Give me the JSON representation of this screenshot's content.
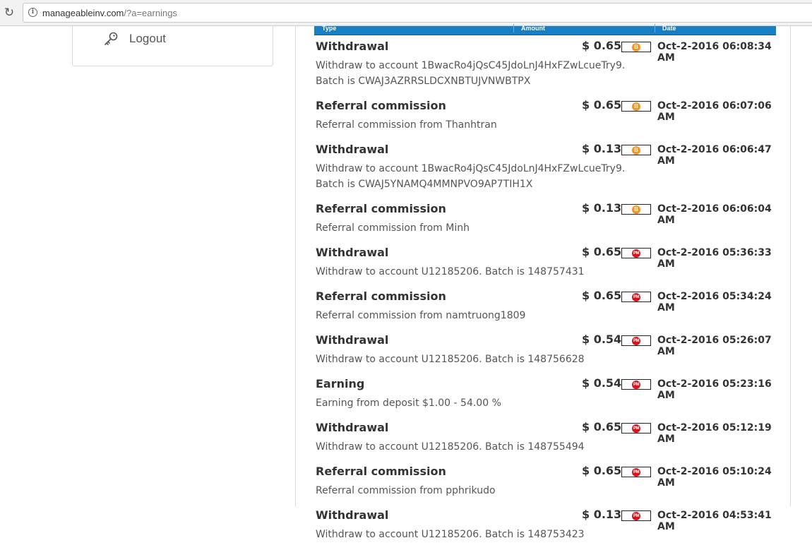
{
  "browser": {
    "url_host": "manageableinv.com",
    "url_path": "/?a=earnings"
  },
  "sidebar": {
    "logout_label": "Logout"
  },
  "table": {
    "headers": {
      "type": "Type",
      "amount": "Amount",
      "date": "Date"
    },
    "rows": [
      {
        "type": "Withdrawal",
        "amount": "$ 0.65",
        "system": "btc",
        "date": "Oct-2-2016 06:08:34 AM",
        "desc": "Withdraw to account 1BwacRo4jQsC45JdoLnJ4HxFZwLcueTry9. Batch is CWAJ3AZRRSLDCXNBTUJVNWBTPX"
      },
      {
        "type": "Referral commission",
        "amount": "$ 0.65",
        "system": "btc",
        "date": "Oct-2-2016 06:07:06 AM",
        "desc": "Referral commission from Thanhtran"
      },
      {
        "type": "Withdrawal",
        "amount": "$ 0.13",
        "system": "btc",
        "date": "Oct-2-2016 06:06:47 AM",
        "desc": "Withdraw to account 1BwacRo4jQsC45JdoLnJ4HxFZwLcueTry9. Batch is CWAJ5YNAMQ4MMNPVO9AP7TIH1X"
      },
      {
        "type": "Referral commission",
        "amount": "$ 0.13",
        "system": "btc",
        "date": "Oct-2-2016 06:06:04 AM",
        "desc": "Referral commission from Minh"
      },
      {
        "type": "Withdrawal",
        "amount": "$ 0.65",
        "system": "pm",
        "date": "Oct-2-2016 05:36:33 AM",
        "desc": "Withdraw to account U12185206. Batch is 148757431"
      },
      {
        "type": "Referral commission",
        "amount": "$ 0.65",
        "system": "pm",
        "date": "Oct-2-2016 05:34:24 AM",
        "desc": "Referral commission from namtruong1809"
      },
      {
        "type": "Withdrawal",
        "amount": "$ 0.54",
        "system": "pm",
        "date": "Oct-2-2016 05:26:07 AM",
        "desc": "Withdraw to account U12185206. Batch is 148756628"
      },
      {
        "type": "Earning",
        "amount": "$ 0.54",
        "system": "pm",
        "date": "Oct-2-2016 05:23:16 AM",
        "desc": "Earning from deposit $1.00 - 54.00 %"
      },
      {
        "type": "Withdrawal",
        "amount": "$ 0.65",
        "system": "pm",
        "date": "Oct-2-2016 05:12:19 AM",
        "desc": "Withdraw to account U12185206. Batch is 148755494"
      },
      {
        "type": "Referral commission",
        "amount": "$ 0.65",
        "system": "pm",
        "date": "Oct-2-2016 05:10:24 AM",
        "desc": "Referral commission from pphrikudo"
      },
      {
        "type": "Withdrawal",
        "amount": "$ 0.13",
        "system": "pm",
        "date": "Oct-2-2016 04:53:41 AM",
        "desc": "Withdraw to account U12185206. Batch is 148753423"
      }
    ]
  },
  "payment_icons": {
    "btc": "B",
    "pm": "PM"
  },
  "colors": {
    "header_blue": "#1a7ec2",
    "btc_orange": "#f7931a",
    "pm_red": "#d7141a"
  }
}
